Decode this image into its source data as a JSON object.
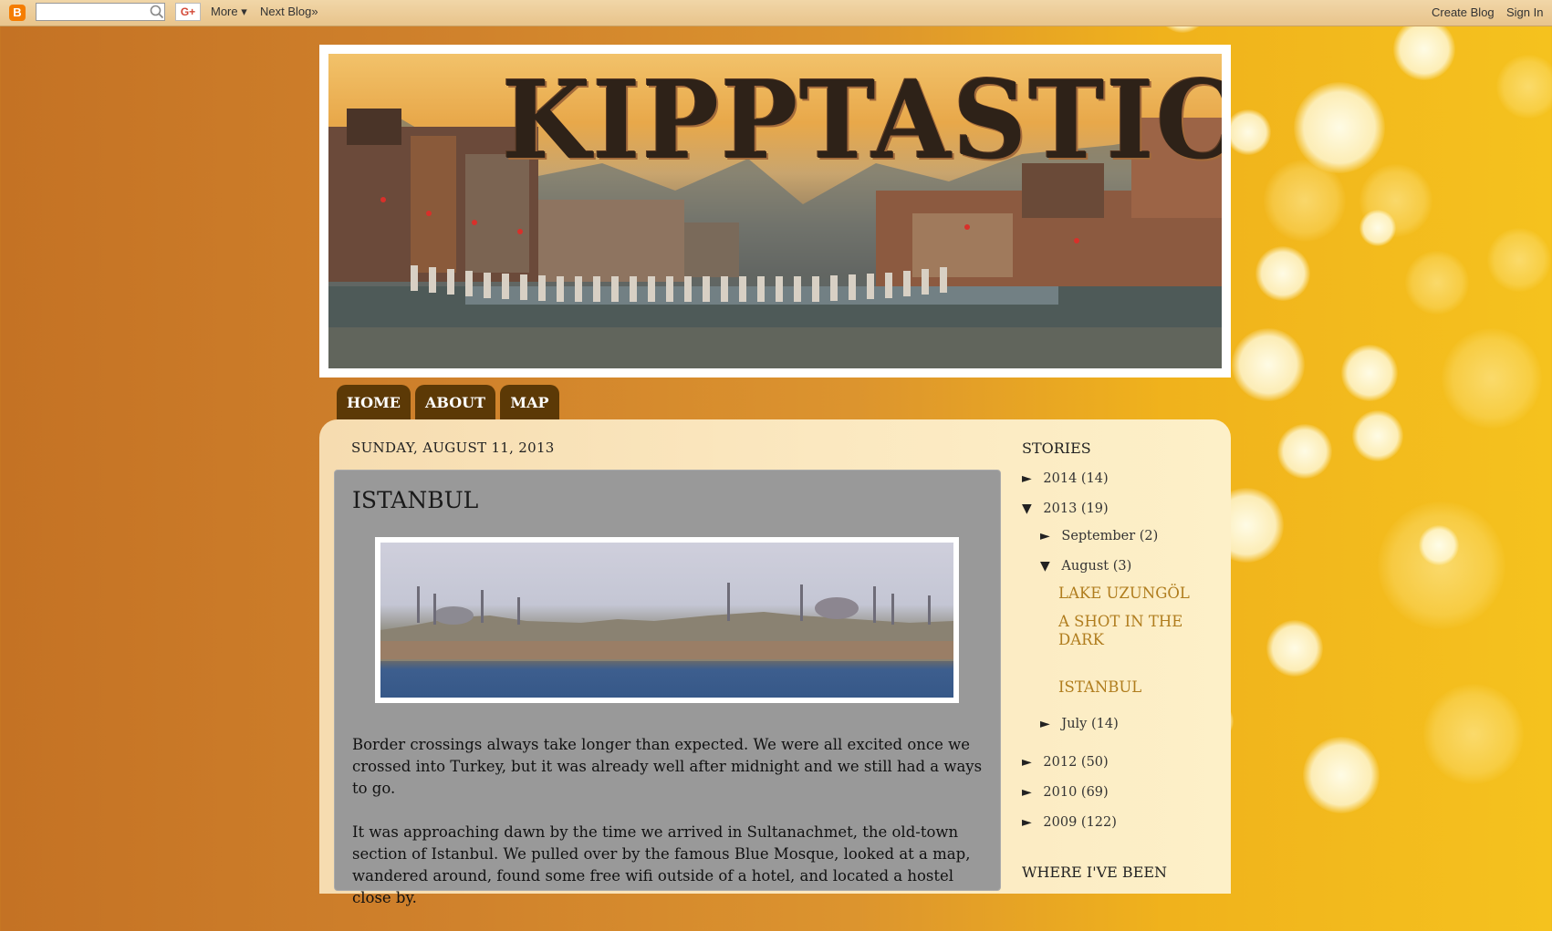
{
  "navbar": {
    "blogger_logo": "B",
    "search_placeholder": "",
    "gplus_label": "G+",
    "more_label": "More ▾",
    "next_blog_label": "Next Blog»",
    "create_blog_label": "Create Blog",
    "sign_in_label": "Sign In"
  },
  "header": {
    "title": "KIPPTASTIC"
  },
  "tabs": [
    {
      "label": "HOME"
    },
    {
      "label": "ABOUT"
    },
    {
      "label": "MAP"
    }
  ],
  "post": {
    "date": "SUNDAY, AUGUST 11, 2013",
    "title": "ISTANBUL",
    "paragraphs": [
      "Border crossings always take longer than expected. We were all excited once we crossed into Turkey, but it was already well after midnight and we still had a ways to go.",
      "It was approaching dawn by the time we arrived in Sultanachmet, the old-town section of Istanbul. We pulled over by the famous Blue Mosque, looked at a map, wandered around, found some free wifi outside of a hotel, and located a hostel close by."
    ]
  },
  "sidebar": {
    "stories_title": "STORIES",
    "archive": [
      {
        "toggle": "►",
        "label": "2014",
        "count": "(14)"
      },
      {
        "toggle": "▼",
        "label": "2013",
        "count": "(19)"
      },
      {
        "toggle": "►",
        "label": "September",
        "count": "(2)"
      },
      {
        "toggle": "▼",
        "label": "August",
        "count": "(3)"
      },
      {
        "toggle": "►",
        "label": "July",
        "count": "(14)"
      },
      {
        "toggle": "►",
        "label": "2012",
        "count": "(50)"
      },
      {
        "toggle": "►",
        "label": "2010",
        "count": "(69)"
      },
      {
        "toggle": "►",
        "label": "2009",
        "count": "(122)"
      }
    ],
    "august_posts": [
      "LAKE UZUNGÖL",
      "A SHOT IN THE DARK",
      "ISTANBUL"
    ],
    "where_title": "WHERE I'VE BEEN"
  },
  "colors": {
    "tab_bg": "#5c3906",
    "post_bg": "#999999",
    "link": "#b07d1e"
  }
}
